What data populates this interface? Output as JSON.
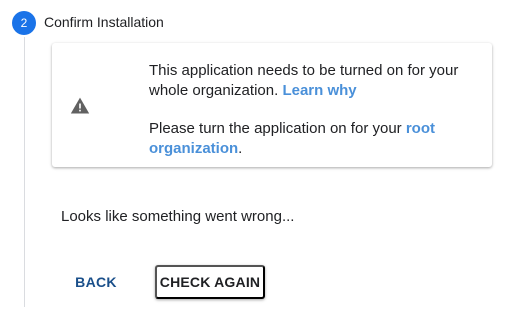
{
  "step": {
    "number": "2",
    "title": "Confirm Installation"
  },
  "notice": {
    "icon": "warning-icon",
    "line1_text": "This application needs to be turned on for your whole organization.",
    "learn_link": "Learn why",
    "line2_text": "Please turn the application on for your",
    "root_link": "root organization",
    "line2_end": "."
  },
  "status": {
    "message": "Looks like something went wrong..."
  },
  "actions": {
    "back_label": "BACK",
    "check_again_label": "CHECK AGAIN"
  },
  "colors": {
    "step_badge": "#1a73e8",
    "link": "#4a90d9",
    "back_button_text": "#1a4f8a",
    "warning_icon": "#616161"
  }
}
